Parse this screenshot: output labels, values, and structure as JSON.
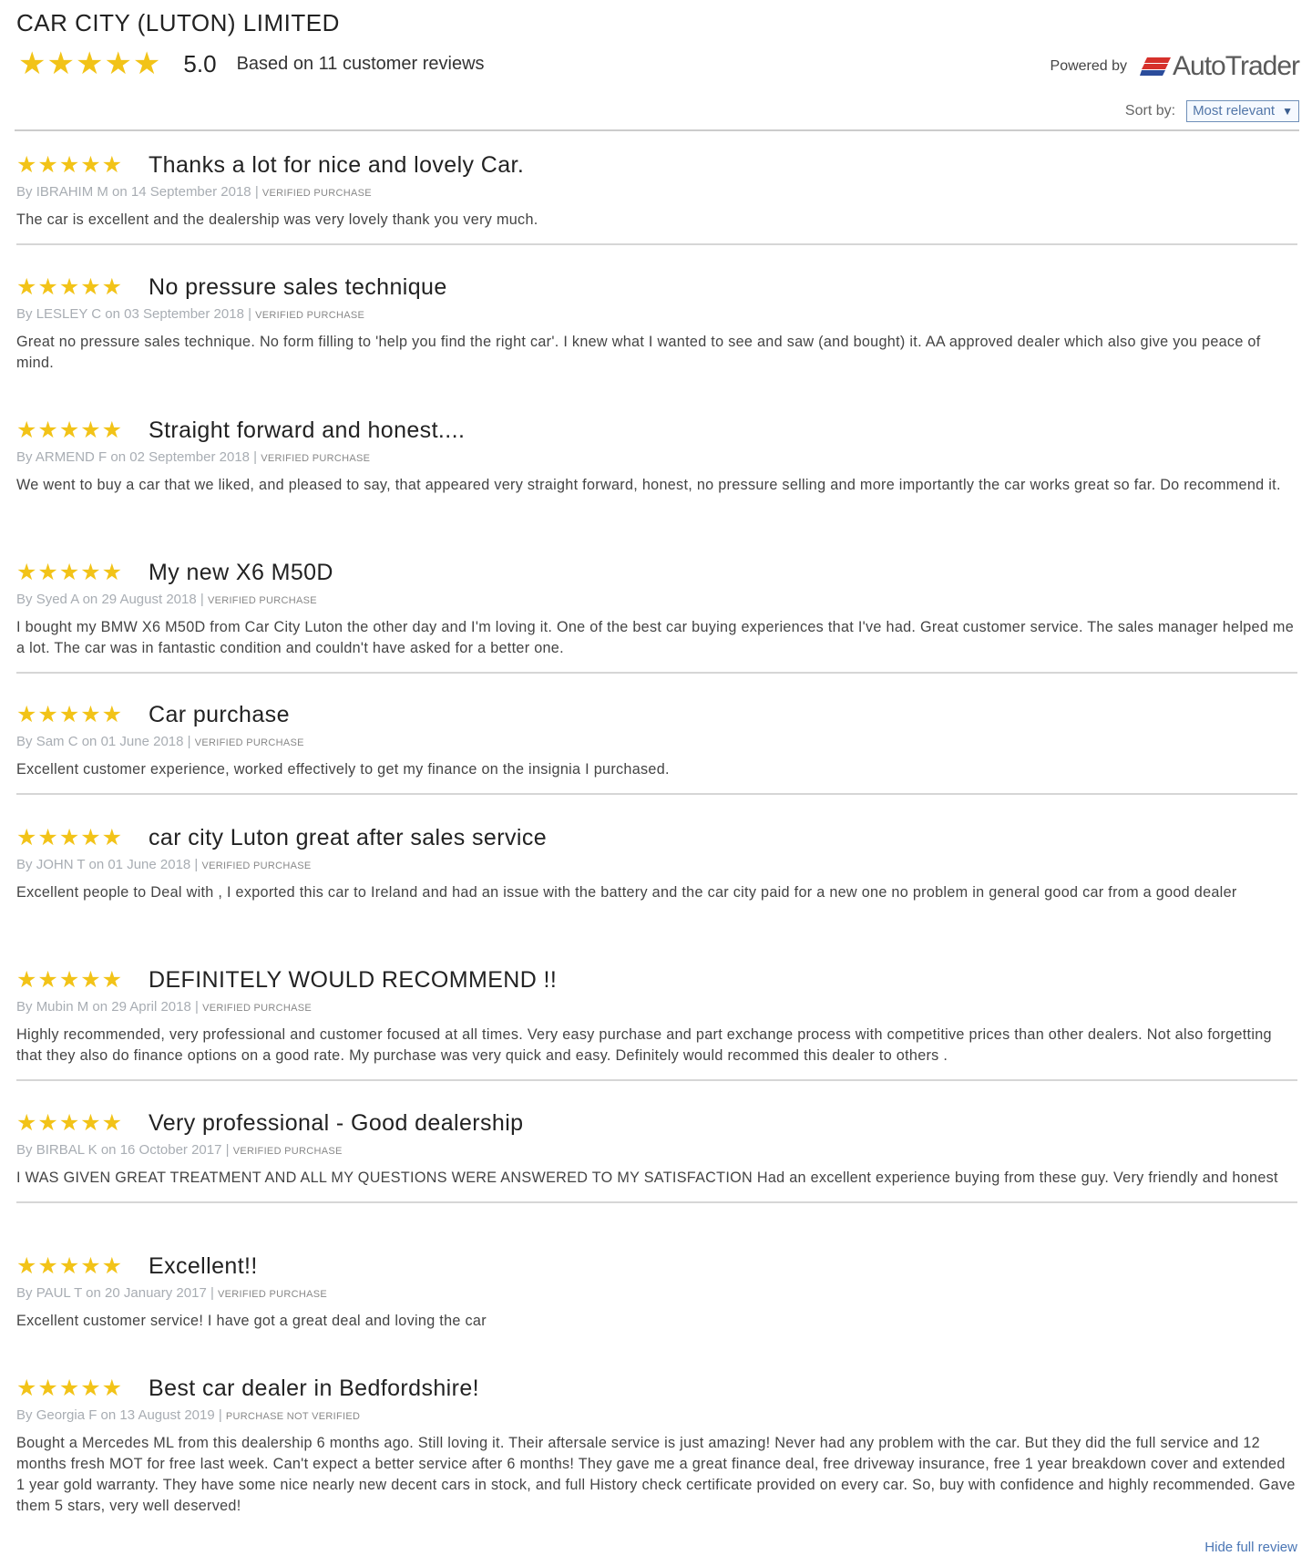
{
  "header": {
    "dealer_name": "CAR CITY (LUTON) LIMITED",
    "rating_stars": "★★★★★",
    "score": "5.0",
    "based_on": "Based on 11 customer reviews",
    "powered_by": "Powered by",
    "brand": "AutoTrader",
    "sort_label": "Sort by:",
    "sort_value": "Most relevant",
    "sort_caret": "▼"
  },
  "reviews": [
    {
      "stars": "★★★★★",
      "title": "Thanks a lot for nice and lovely Car.",
      "author": "IBRAHIM M",
      "date": "14 September 2018",
      "tag": "VERIFIED PURCHASE",
      "body": "The car is excellent and the dealership was very lovely thank you very much."
    },
    {
      "stars": "★★★★★",
      "title": "No pressure sales technique",
      "author": "LESLEY C",
      "date": "03 September 2018",
      "tag": "VERIFIED PURCHASE",
      "body": "Great no pressure sales technique. No form filling to 'help you find the right car'. I knew what I wanted to see and saw (and bought) it. AA approved dealer which also give you peace of mind."
    },
    {
      "stars": "★★★★★",
      "title": "Straight forward and honest....",
      "author": "ARMEND F",
      "date": "02 September 2018",
      "tag": "VERIFIED PURCHASE",
      "body": "We went to buy a car that we liked, and pleased to say, that appeared very straight forward, honest, no pressure selling and more importantly the car works great so far. Do recommend it."
    },
    {
      "stars": "★★★★★",
      "title": "My new X6 M50D",
      "author": "Syed A",
      "date": "29 August 2018",
      "tag": "VERIFIED PURCHASE",
      "body": "I bought my BMW X6 M50D from Car City Luton the other day and I'm loving it. One of the best car buying experiences that I've had. Great customer service. The sales manager helped me a lot. The car was in fantastic condition and couldn't have asked for a better one."
    },
    {
      "stars": "★★★★★",
      "title": "Car purchase",
      "author": "Sam C",
      "date": "01 June 2018",
      "tag": "VERIFIED PURCHASE",
      "body": "Excellent customer experience, worked effectively to get my finance on the insignia I purchased."
    },
    {
      "stars": "★★★★★",
      "title": "car city Luton great after sales service",
      "author": "JOHN T",
      "date": "01 June 2018",
      "tag": "VERIFIED PURCHASE",
      "body": "Excellent people to Deal with , I exported this car to Ireland and had an issue with the battery and the car city paid for a new one no problem in general good car from a good dealer"
    },
    {
      "stars": "★★★★★",
      "title": "DEFINITELY WOULD RECOMMEND !!",
      "author": "Mubin M",
      "date": "29 April 2018",
      "tag": "VERIFIED PURCHASE",
      "body": "Highly recommended, very professional and customer focused at all times. Very easy purchase and part exchange process with competitive prices than other dealers. Not also forgetting that they also do finance options on a good rate. My purchase was very quick and easy. Definitely would recommed this dealer to others ."
    },
    {
      "stars": "★★★★★",
      "title": "Very professional - Good dealership",
      "author": "BIRBAL K",
      "date": "16 October 2017",
      "tag": "VERIFIED PURCHASE",
      "body": "I WAS GIVEN GREAT TREATMENT AND ALL MY QUESTIONS WERE ANSWERED TO MY SATISFACTION Had an excellent experience buying from these guy. Very friendly and honest"
    },
    {
      "stars": "★★★★★",
      "title": "Excellent!!",
      "author": "PAUL T",
      "date": "20 January 2017",
      "tag": "VERIFIED PURCHASE",
      "body": "Excellent customer service! I have got a great deal and loving the car"
    },
    {
      "stars": "★★★★★",
      "title": "Best car dealer in Bedfordshire!",
      "author": "Georgia F",
      "date": "13 August 2019",
      "tag": "PURCHASE NOT VERIFIED",
      "body": "Bought a Mercedes ML from this dealership 6 months ago. Still loving it. Their aftersale service is just amazing! Never had any problem with the car. But they did the full service and 12 months fresh MOT for free last week. Can't expect a better service after 6 months! They gave me a great finance deal, free driveway insurance, free 1 year breakdown cover and extended 1 year gold warranty. They have some nice nearly new decent cars in stock, and full History check certificate provided on every car. So, buy with confidence and highly recommended. Gave them 5 stars, very well deserved!"
    }
  ],
  "footer": {
    "hide_link": "Hide full review"
  },
  "colors": {
    "star": "#f2c318",
    "link": "#4a76b5",
    "brand_red": "#d6312b",
    "brand_blue": "#2b4c9b"
  }
}
